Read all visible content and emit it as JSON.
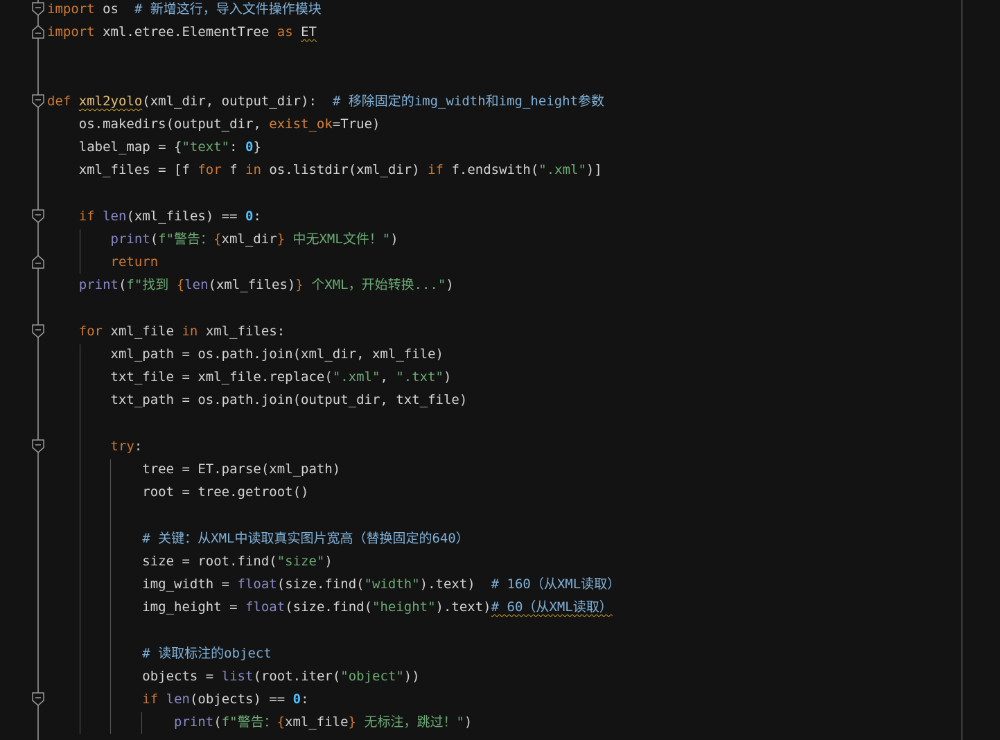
{
  "editor": {
    "lines": [
      [
        {
          "t": "import",
          "c": "kw"
        },
        {
          "t": " os  ",
          "c": "txt"
        },
        {
          "t": "# 新增这行，导入文件操作模块",
          "c": "cm"
        }
      ],
      [
        {
          "t": "import",
          "c": "kw"
        },
        {
          "t": " xml.etree.ElementTree ",
          "c": "txt"
        },
        {
          "t": "as",
          "c": "kw"
        },
        {
          "t": " ",
          "c": "txt"
        },
        {
          "t": "ET",
          "c": "txt",
          "u": true
        }
      ],
      [],
      [],
      [
        {
          "t": "def",
          "c": "kw"
        },
        {
          "t": " ",
          "c": "txt"
        },
        {
          "t": "xml2yolo",
          "c": "fn",
          "u": true
        },
        {
          "t": "(xml_dir, output_dir):  ",
          "c": "txt"
        },
        {
          "t": "# 移除固定的img_width和img_height参数",
          "c": "cm"
        }
      ],
      [
        {
          "t": "    os.makedirs(output_dir, ",
          "c": "txt"
        },
        {
          "t": "exist_ok",
          "c": "pn"
        },
        {
          "t": "=True)",
          "c": "txt"
        }
      ],
      [
        {
          "t": "    label_map = {",
          "c": "txt"
        },
        {
          "t": "\"text\"",
          "c": "str"
        },
        {
          "t": ": ",
          "c": "txt"
        },
        {
          "t": "0",
          "c": "num"
        },
        {
          "t": "}",
          "c": "txt"
        }
      ],
      [
        {
          "t": "    xml_files = [f ",
          "c": "txt"
        },
        {
          "t": "for",
          "c": "kw"
        },
        {
          "t": " f ",
          "c": "txt"
        },
        {
          "t": "in",
          "c": "kw"
        },
        {
          "t": " os.listdir(xml_dir) ",
          "c": "txt"
        },
        {
          "t": "if",
          "c": "kw"
        },
        {
          "t": " f.endswith(",
          "c": "txt"
        },
        {
          "t": "\".xml\"",
          "c": "str"
        },
        {
          "t": ")]",
          "c": "txt"
        }
      ],
      [],
      [
        {
          "t": "    ",
          "c": "txt"
        },
        {
          "t": "if",
          "c": "kw"
        },
        {
          "t": " ",
          "c": "txt"
        },
        {
          "t": "len",
          "c": "bi"
        },
        {
          "t": "(xml_files) == ",
          "c": "txt"
        },
        {
          "t": "0",
          "c": "num"
        },
        {
          "t": ":",
          "c": "txt"
        }
      ],
      [
        {
          "t": "        ",
          "c": "txt"
        },
        {
          "t": "print",
          "c": "bi"
        },
        {
          "t": "(",
          "c": "txt"
        },
        {
          "t": "f\"警告：",
          "c": "str"
        },
        {
          "t": "{",
          "c": "kw"
        },
        {
          "t": "xml_dir",
          "c": "txt"
        },
        {
          "t": "}",
          "c": "kw"
        },
        {
          "t": " 中无XML文件！\"",
          "c": "str"
        },
        {
          "t": ")",
          "c": "txt"
        }
      ],
      [
        {
          "t": "        ",
          "c": "txt"
        },
        {
          "t": "return",
          "c": "kw"
        }
      ],
      [
        {
          "t": "    ",
          "c": "txt"
        },
        {
          "t": "print",
          "c": "bi"
        },
        {
          "t": "(",
          "c": "txt"
        },
        {
          "t": "f\"找到 ",
          "c": "str"
        },
        {
          "t": "{",
          "c": "kw"
        },
        {
          "t": "len",
          "c": "bi"
        },
        {
          "t": "(xml_files)",
          "c": "txt"
        },
        {
          "t": "}",
          "c": "kw"
        },
        {
          "t": " 个XML，开始转换...\"",
          "c": "str"
        },
        {
          "t": ")",
          "c": "txt"
        }
      ],
      [],
      [
        {
          "t": "    ",
          "c": "txt"
        },
        {
          "t": "for",
          "c": "kw"
        },
        {
          "t": " xml_file ",
          "c": "txt"
        },
        {
          "t": "in",
          "c": "kw"
        },
        {
          "t": " xml_files:",
          "c": "txt"
        }
      ],
      [
        {
          "t": "        xml_path = os.path.join(xml_dir, xml_file)",
          "c": "txt"
        }
      ],
      [
        {
          "t": "        txt_file = xml_file.replace(",
          "c": "txt"
        },
        {
          "t": "\".xml\"",
          "c": "str"
        },
        {
          "t": ", ",
          "c": "txt"
        },
        {
          "t": "\".txt\"",
          "c": "str"
        },
        {
          "t": ")",
          "c": "txt"
        }
      ],
      [
        {
          "t": "        txt_path = os.path.join(output_dir, txt_file)",
          "c": "txt"
        }
      ],
      [],
      [
        {
          "t": "        ",
          "c": "txt"
        },
        {
          "t": "try",
          "c": "kw"
        },
        {
          "t": ":",
          "c": "txt"
        }
      ],
      [
        {
          "t": "            tree = ET.parse(xml_path)",
          "c": "txt"
        }
      ],
      [
        {
          "t": "            root = tree.getroot()",
          "c": "txt"
        }
      ],
      [],
      [
        {
          "t": "            ",
          "c": "txt"
        },
        {
          "t": "# 关键：从XML中读取真实图片宽高（替换固定的640）",
          "c": "cm"
        }
      ],
      [
        {
          "t": "            size = root.find(",
          "c": "txt"
        },
        {
          "t": "\"size\"",
          "c": "str"
        },
        {
          "t": ")",
          "c": "txt"
        }
      ],
      [
        {
          "t": "            img_width = ",
          "c": "txt"
        },
        {
          "t": "float",
          "c": "bi"
        },
        {
          "t": "(size.find(",
          "c": "txt"
        },
        {
          "t": "\"width\"",
          "c": "str"
        },
        {
          "t": ").text)  ",
          "c": "txt"
        },
        {
          "t": "# 160（从XML读取）",
          "c": "cm"
        }
      ],
      [
        {
          "t": "            img_height = ",
          "c": "txt"
        },
        {
          "t": "float",
          "c": "bi"
        },
        {
          "t": "(size.find(",
          "c": "txt"
        },
        {
          "t": "\"height\"",
          "c": "str"
        },
        {
          "t": ").text)",
          "c": "txt"
        },
        {
          "t": "# 60（从XML读取）",
          "c": "cm",
          "u": true
        }
      ],
      [],
      [
        {
          "t": "            ",
          "c": "txt"
        },
        {
          "t": "# 读取标注的object",
          "c": "cm"
        }
      ],
      [
        {
          "t": "            objects = ",
          "c": "txt"
        },
        {
          "t": "list",
          "c": "bi"
        },
        {
          "t": "(root.iter(",
          "c": "txt"
        },
        {
          "t": "\"object\"",
          "c": "str"
        },
        {
          "t": "))",
          "c": "txt"
        }
      ],
      [
        {
          "t": "            ",
          "c": "txt"
        },
        {
          "t": "if",
          "c": "kw"
        },
        {
          "t": " ",
          "c": "txt"
        },
        {
          "t": "len",
          "c": "bi"
        },
        {
          "t": "(objects) == ",
          "c": "txt"
        },
        {
          "t": "0",
          "c": "num"
        },
        {
          "t": ":",
          "c": "txt"
        }
      ],
      [
        {
          "t": "                ",
          "c": "txt"
        },
        {
          "t": "print",
          "c": "bi"
        },
        {
          "t": "(",
          "c": "txt"
        },
        {
          "t": "f\"警告：",
          "c": "str"
        },
        {
          "t": "{",
          "c": "kw"
        },
        {
          "t": "xml_file",
          "c": "txt"
        },
        {
          "t": "}",
          "c": "kw"
        },
        {
          "t": " 无标注，跳过！\"",
          "c": "str"
        },
        {
          "t": ")",
          "c": "txt"
        }
      ]
    ],
    "folds": [
      {
        "line": 0,
        "kind": "open"
      },
      {
        "line": 1,
        "kind": "close"
      },
      {
        "line": 4,
        "kind": "open"
      },
      {
        "line": 9,
        "kind": "open"
      },
      {
        "line": 11,
        "kind": "close"
      },
      {
        "line": 14,
        "kind": "open"
      },
      {
        "line": 19,
        "kind": "open"
      },
      {
        "line": 30,
        "kind": "open"
      }
    ],
    "guides": [
      {
        "col": 4,
        "from": 10,
        "to": 11
      },
      {
        "col": 4,
        "from": 15,
        "to": 31
      },
      {
        "col": 8,
        "from": 20,
        "to": 31
      },
      {
        "col": 12,
        "from": 31,
        "to": 31
      }
    ]
  }
}
